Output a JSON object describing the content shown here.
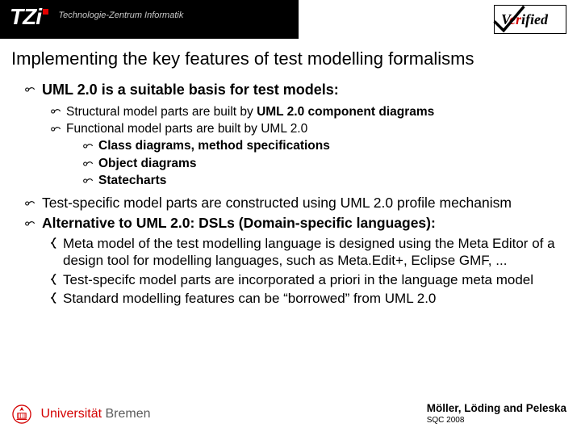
{
  "header": {
    "tzi_logo_text": "TZi",
    "tzi_subtitle": "Technologie-Zentrum Informatik",
    "verified_prefix": "V",
    "verified_mid": "er",
    "verified_suffix": "ified"
  },
  "title": "Implementing the key features of test modelling formalisms",
  "content": {
    "p1": "UML 2.0 is a suitable basis for test models:",
    "p1a_pre": "Structural model parts are built by ",
    "p1a_bold": "UML 2.0 component diagrams",
    "p1b": "Functional model parts are built by UML 2.0",
    "p1b_i": "Class diagrams, method specifications",
    "p1b_ii": "Object diagrams",
    "p1b_iii": "Statecharts",
    "p2": "Test-specific model parts are constructed using UML 2.0 profile mechanism",
    "p3": "Alternative to UML 2.0: DSLs (Domain-specific languages):",
    "p3a": "Meta model of the test modelling language is designed using the Meta Editor of a design tool for modelling languages, such as Meta.Edit+, Eclipse GMF, ...",
    "p3b": "Test-specifc model parts are incorporated a priori in the language meta model",
    "p3c": "Standard modelling features can be “borrowed” from UML 2.0"
  },
  "footer": {
    "uni_prefix": "Universität",
    "uni_name": "Bremen",
    "authors": "Möller, Löding and Peleska",
    "conf": "SQC 2008"
  }
}
